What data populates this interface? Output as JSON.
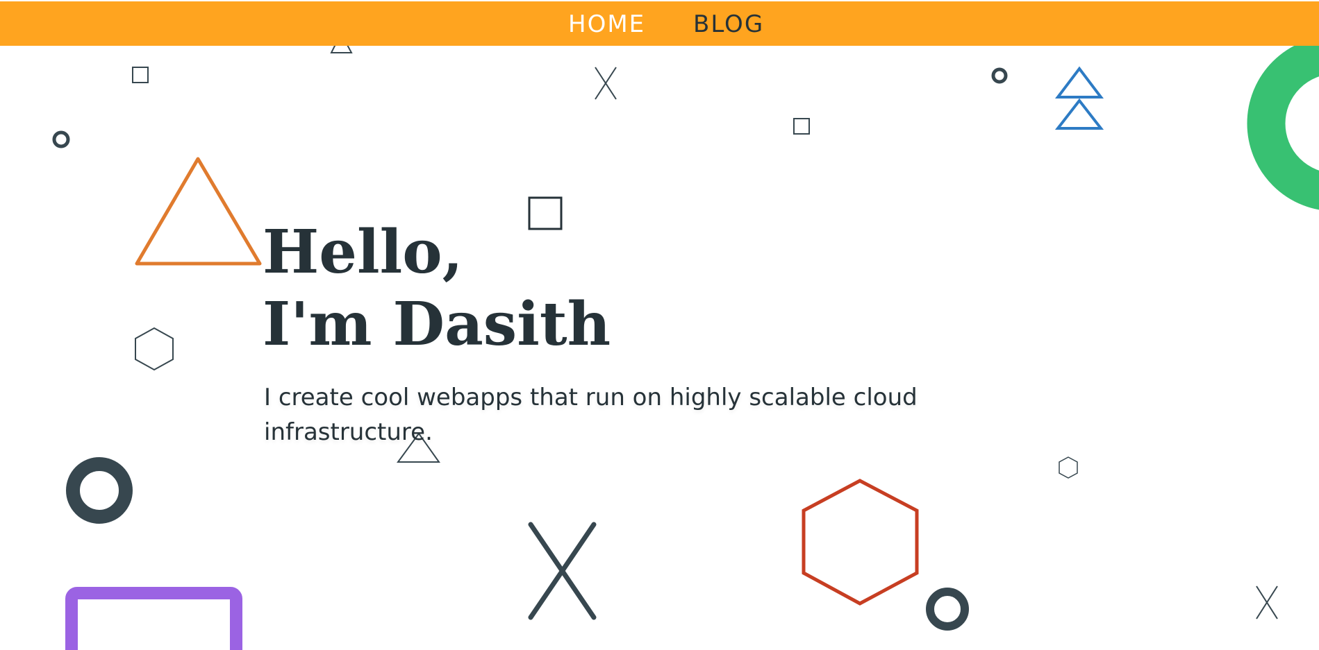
{
  "nav": {
    "home_label": "HOME",
    "blog_label": "BLOG",
    "background_color": "#FFA41F"
  },
  "hero": {
    "title_line1": "Hello,",
    "title_line2": "I'm Dasith",
    "subtitle": "I create cool webapps that run on highly scalable cloud infrastructure."
  },
  "colors": {
    "text_dark": "#263238",
    "shape_dark": "#37474F",
    "accent_orange": "#E07B2E",
    "accent_blue": "#2D7BC4",
    "accent_green": "#38C172",
    "accent_purple": "#9B63E3",
    "accent_red": "#C73E22"
  }
}
